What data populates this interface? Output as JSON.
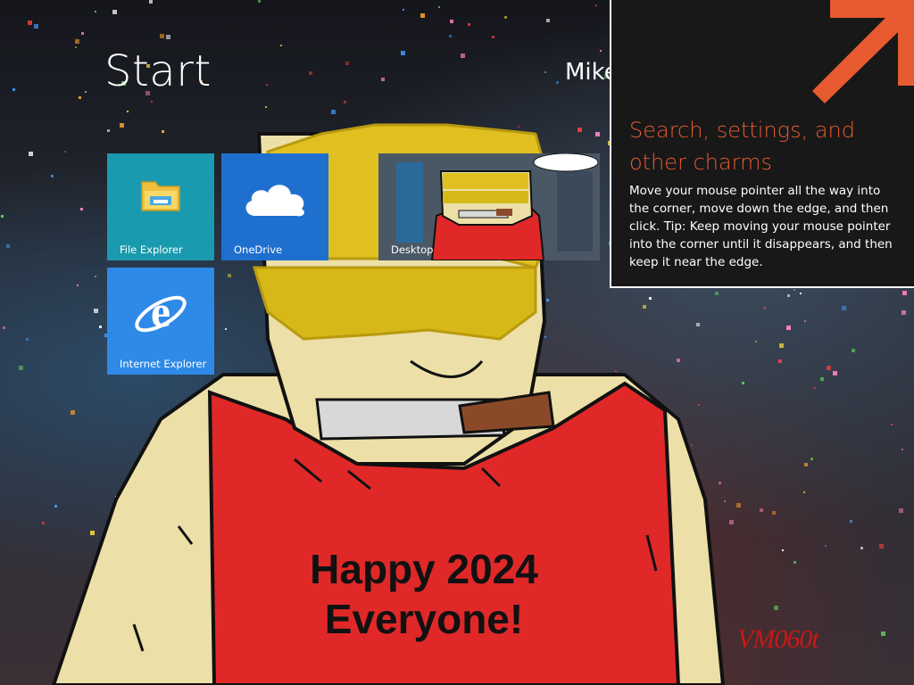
{
  "start": {
    "title": "Start",
    "user_name": "Mike"
  },
  "tiles": [
    {
      "label": "File Explorer",
      "icon": "folder-icon",
      "color": "#1a9aae"
    },
    {
      "label": "OneDrive",
      "icon": "cloud-icon",
      "color": "#1f6fcf"
    },
    {
      "label": "Desktop",
      "icon": "desktop-wallpaper-preview",
      "color": "#5b6a78"
    },
    {
      "label": "Internet Explorer",
      "icon": "ie-icon",
      "color": "#2e8ae6"
    }
  ],
  "wallpaper": {
    "caption_line1": "Happy 2024",
    "caption_line2": "Everyone!",
    "watermark": "VM060t"
  },
  "charms_tip": {
    "heading": "Search, settings, and other charms",
    "body": "Move your mouse pointer all the way into the corner, move down the edge, and then click. Tip: Keep moving your mouse pointer into the corner until it disappears, and then keep it near the edge.",
    "accent_color": "#e85a30"
  }
}
